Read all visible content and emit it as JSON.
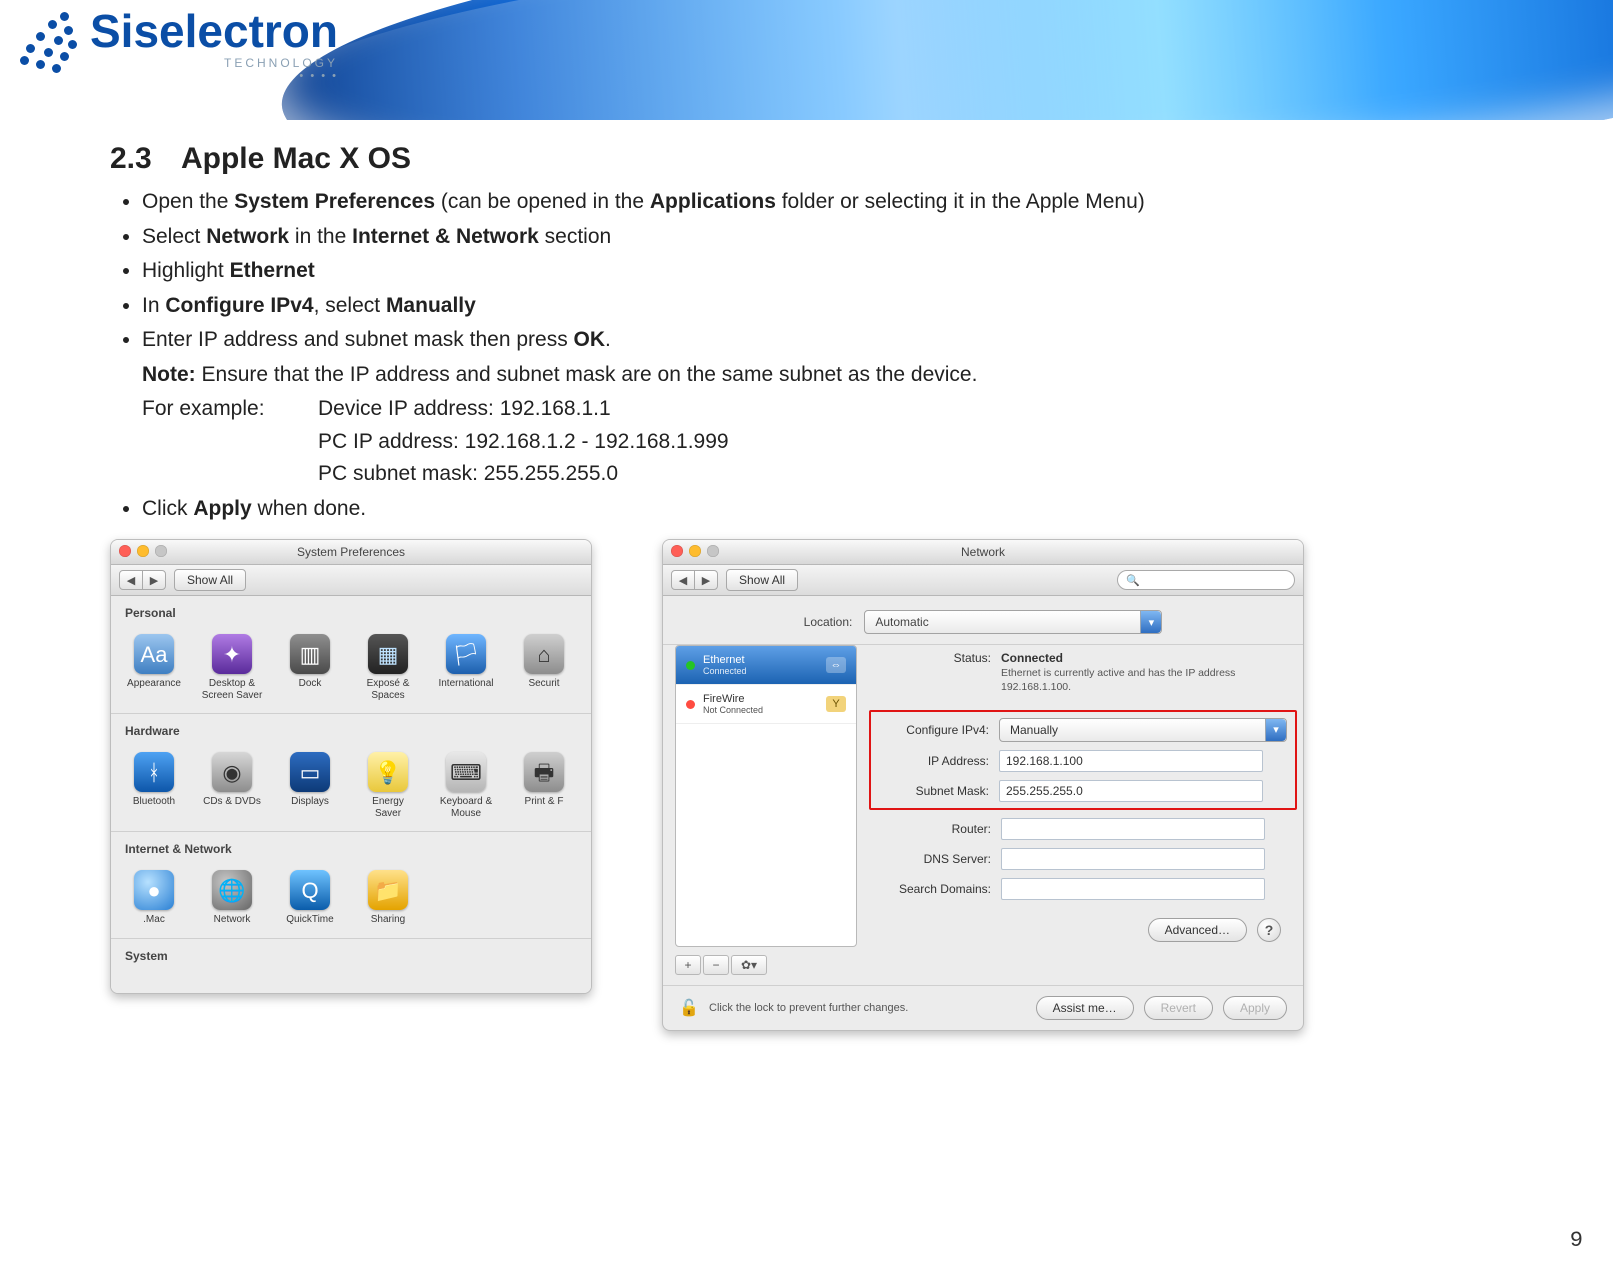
{
  "brand": {
    "name": "Siselectron",
    "sub": "TECHNOLOGY"
  },
  "section": {
    "num": "2.3",
    "title": "Apple Mac X OS"
  },
  "steps": {
    "s1a": "Open the ",
    "s1b": "System Preferences",
    "s1c": " (can be opened in the ",
    "s1d": "Applications",
    "s1e": " folder or selecting it in the Apple Menu)",
    "s2a": "Select ",
    "s2b": "Network",
    "s2c": " in the ",
    "s2d": "Internet & Network",
    "s2e": " section",
    "s3a": "Highlight ",
    "s3b": "Ethernet",
    "s4a": "In ",
    "s4b": "Configure IPv4",
    "s4c": ", select ",
    "s4d": "Manually",
    "s5a": "Enter IP address and subnet mask then press ",
    "s5b": "OK",
    "s5c": ".",
    "note_lead": "Note:",
    "note_rest": " Ensure that the IP address and subnet mask are on the same subnet as the device.",
    "ex_label": "For example:",
    "ex1": "Device IP address: 192.168.1.1",
    "ex2": "PC IP address: 192.168.1.2 - 192.168.1.999",
    "ex3": "PC subnet mask: 255.255.255.0",
    "s6a": "Click ",
    "s6b": "Apply",
    "s6c": " when done."
  },
  "sysprefs": {
    "title": "System Preferences",
    "show_all": "Show All",
    "sections": {
      "personal": "Personal",
      "hardware": "Hardware",
      "internet": "Internet & Network",
      "system": "System"
    },
    "icons": {
      "appearance": "Appearance",
      "desktop": "Desktop &\nScreen Saver",
      "dock": "Dock",
      "expose": "Exposé &\nSpaces",
      "intl": "International",
      "security": "Securit",
      "bluetooth": "Bluetooth",
      "cds": "CDs & DVDs",
      "displays": "Displays",
      "energy": "Energy\nSaver",
      "kb": "Keyboard &\nMouse",
      "print": "Print & F",
      "mac": ".Mac",
      "network": "Network",
      "quicktime": "QuickTime",
      "sharing": "Sharing"
    }
  },
  "netwin": {
    "title": "Network",
    "show_all": "Show All",
    "search_placeholder": "",
    "location_label": "Location:",
    "location_value": "Automatic",
    "iface_eth_name": "Ethernet",
    "iface_eth_sub": "Connected",
    "iface_fw_name": "FireWire",
    "iface_fw_sub": "Not Connected",
    "status_label": "Status:",
    "status_value": "Connected",
    "status_desc": "Ethernet is currently active and has the IP address 192.168.1.100.",
    "cfg_label": "Configure IPv4:",
    "cfg_value": "Manually",
    "ip_label": "IP Address:",
    "ip_value": "192.168.1.100",
    "mask_label": "Subnet Mask:",
    "mask_value": "255.255.255.0",
    "router_label": "Router:",
    "dns_label": "DNS Server:",
    "search_domains_label": "Search Domains:",
    "advanced": "Advanced…",
    "lock_text": "Click the lock to prevent further changes.",
    "assist": "Assist me…",
    "revert": "Revert",
    "apply": "Apply"
  },
  "page_number": "9"
}
